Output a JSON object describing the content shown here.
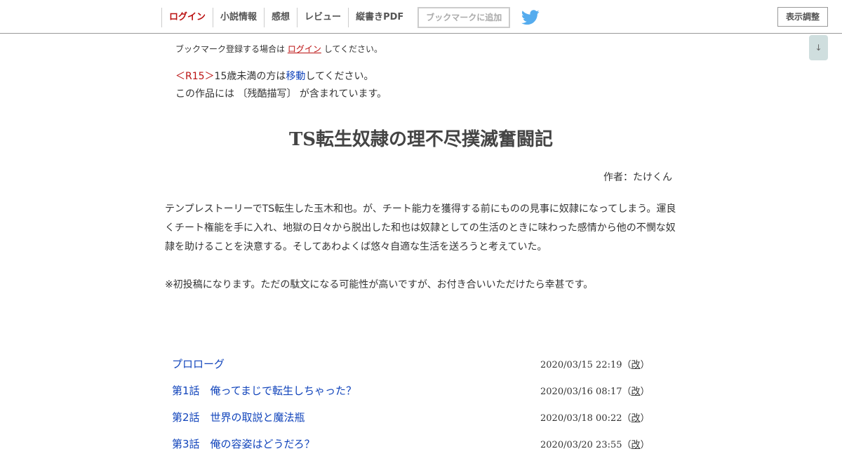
{
  "nav": {
    "items": [
      "ログイン",
      "小説情報",
      "感想",
      "レビュー",
      "縦書きPDF"
    ],
    "bookmark_button": "ブックマークに追加",
    "twitter_icon": "twitter-bird",
    "display_settings": "表示調整",
    "scroll_down": "↓"
  },
  "bookmark_notice": {
    "before": "ブックマーク登録する場合は",
    "login": "ログイン",
    "after": "してください。"
  },
  "rating": {
    "tag": "＜R15＞",
    "text_before": "15歳未満の方は",
    "move_link": "移動",
    "text_after": "してください。"
  },
  "content_warning": "この作品には 〔残酷描写〕 が含まれています。",
  "novel": {
    "title": "TS転生奴隷の理不尽撲滅奮闘記",
    "author": "作者：たけくん",
    "synopsis": [
      "テンプレストーリーでTS転生した玉木和也。が、チート能力を獲得する前にものの見事に奴隷になってしまう。運良くチート権能を手に入れ、地獄の日々から脱出した和也は奴隷としての生活のときに味わった感情から他の不憫な奴隷を助けることを決意する。そしてあわよくば悠々自適な生活を送ろうと考えていた。",
      "※初投稿になります。ただの駄文になる可能性が高いですが、お付き合いいただけたら幸甚です。"
    ]
  },
  "chapters": [
    {
      "title": "プロローグ",
      "date": "2020/03/15 22:19",
      "revised": "改"
    },
    {
      "title": "第1話　俺ってまじで転生しちゃった？",
      "date": "2020/03/16 08:17",
      "revised": "改"
    },
    {
      "title": "第2話　世界の取説と魔法瓶",
      "date": "2020/03/18 00:22",
      "revised": "改"
    },
    {
      "title": "第3話　俺の容姿はどうだろ？",
      "date": "2020/03/20 23:55",
      "revised": "改"
    }
  ],
  "colors": {
    "login_red": "#bb1111",
    "link_blue": "#1144bb",
    "twitter_blue": "#55acee"
  }
}
